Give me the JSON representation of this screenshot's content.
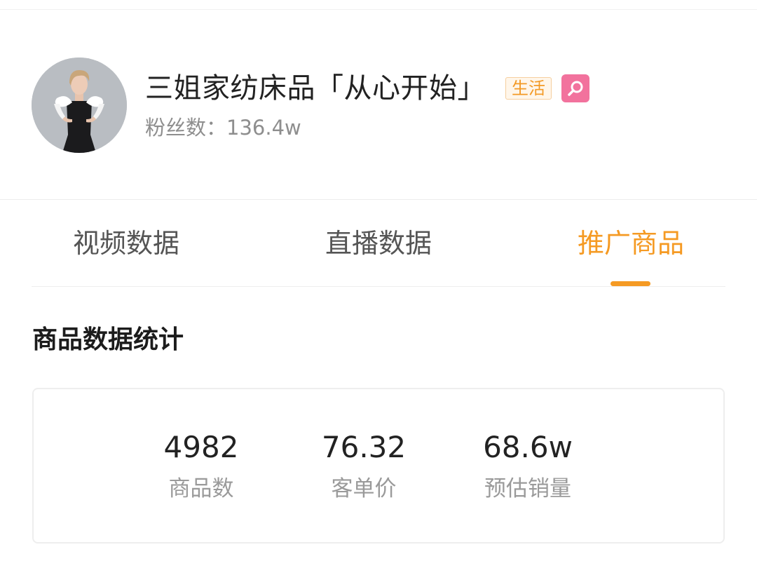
{
  "profile": {
    "name": "三姐家纺床品「从心开始」",
    "category_badge": "生活",
    "fans_label": "粉丝数：",
    "fans_value": "136.4w",
    "search_badge_icon": "search-icon",
    "accent_color": "#f59a23",
    "badge_pink": "#f2729d"
  },
  "tabs": [
    {
      "label": "视频数据",
      "active": false
    },
    {
      "label": "直播数据",
      "active": false
    },
    {
      "label": "推广商品",
      "active": true
    }
  ],
  "section": {
    "title": "商品数据统计"
  },
  "stats": [
    {
      "value": "4982",
      "label": "商品数"
    },
    {
      "value": "76.32",
      "label": "客单价"
    },
    {
      "value": "68.6w",
      "label": "预估销量"
    }
  ]
}
